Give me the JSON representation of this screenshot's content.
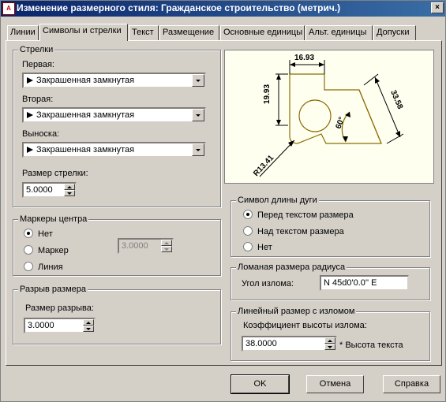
{
  "window": {
    "title": "Изменение размерного стиля: Гражданское строительство (метрич.)",
    "app_icon_text": "A",
    "close_glyph": "×"
  },
  "tabs": [
    "Линии",
    "Символы и стрелки",
    "Текст",
    "Размещение",
    "Основные единицы",
    "Альт. единицы",
    "Допуски"
  ],
  "arrows": {
    "legend": "Стрелки",
    "first_label": "Первая:",
    "first_value": "Закрашенная замкнутая",
    "second_label": "Вторая:",
    "second_value": "Закрашенная замкнутая",
    "leader_label": "Выноска:",
    "leader_value": "Закрашенная замкнутая",
    "size_label": "Размер стрелки:",
    "size_value": "5.0000"
  },
  "center_marks": {
    "legend": "Маркеры центра",
    "options": [
      "Нет",
      "Маркер",
      "Линия"
    ],
    "selected": "Нет",
    "size_value": "3.0000"
  },
  "dim_break": {
    "legend": "Разрыв размера",
    "size_label": "Размер разрыва:",
    "size_value": "3.0000"
  },
  "arc_length": {
    "legend": "Символ длины дуги",
    "options": [
      "Перед текстом размера",
      "Над текстом размера",
      "Нет"
    ],
    "selected": "Перед текстом размера"
  },
  "radius_jog": {
    "legend": "Ломаная размера радиуса",
    "angle_label": "Угол излома:",
    "angle_value": "N 45d0'0.0'' E"
  },
  "linear_jog": {
    "legend": "Линейный размер с изломом",
    "factor_label": "Коэффициент высоты излома:",
    "factor_value": "38.0000",
    "factor_suffix": "* Высота текста"
  },
  "preview": {
    "dim_top": "16.93",
    "dim_left": "19.93",
    "dim_angle": "60°",
    "dim_diag": "33.58",
    "dim_radius": "R13.41"
  },
  "buttons": {
    "ok": "OK",
    "cancel": "Отмена",
    "help": "Справка"
  },
  "colors": {
    "titlebar_start": "#0a246a",
    "titlebar_end": "#3a6ea5",
    "dialog_bg": "#d4d0c8",
    "preview_bg": "#fffff0",
    "preview_lines": "#8a6d00"
  },
  "icons": {
    "arrowhead": "filled-closed-arrow-icon"
  }
}
